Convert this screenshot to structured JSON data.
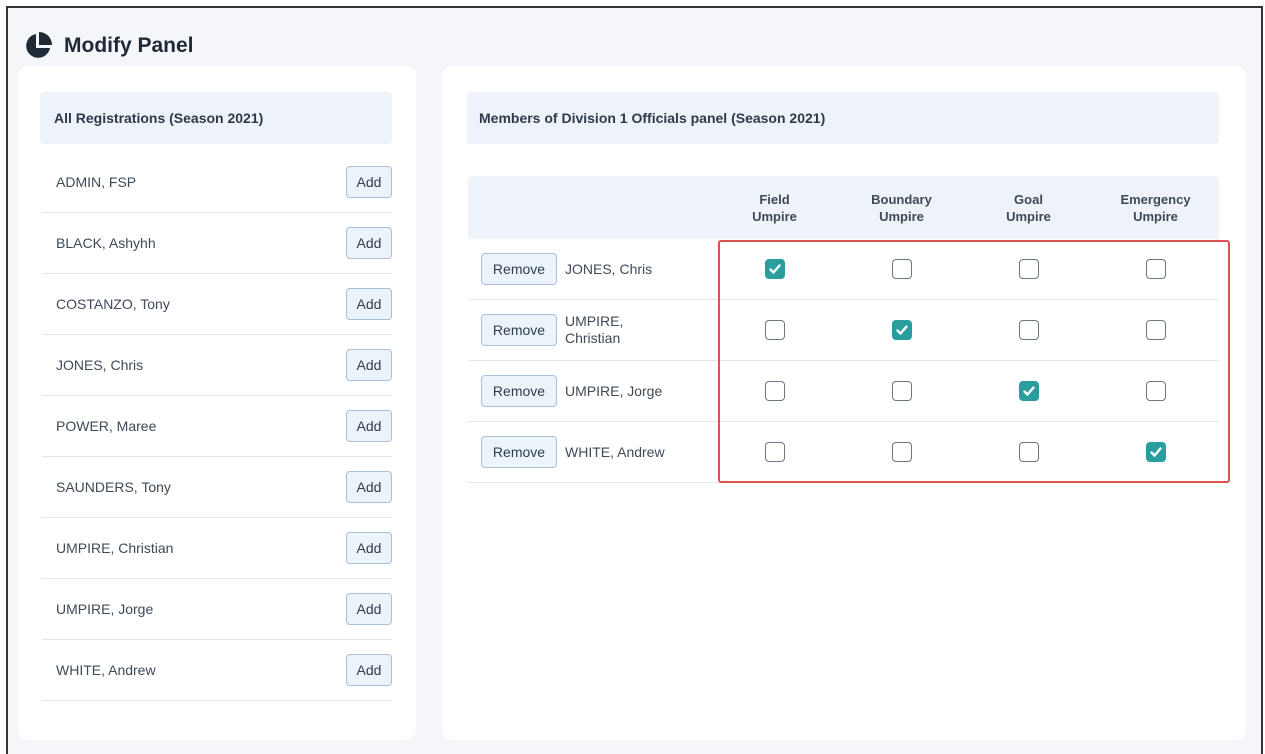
{
  "header": {
    "title": "Modify Panel",
    "icon": "pie-chart-icon"
  },
  "registrations": {
    "title": "All Registrations (Season 2021)",
    "add_label": "Add",
    "items": [
      {
        "name": "ADMIN, FSP"
      },
      {
        "name": "BLACK, Ashyhh"
      },
      {
        "name": "COSTANZO, Tony"
      },
      {
        "name": "JONES, Chris"
      },
      {
        "name": "POWER, Maree"
      },
      {
        "name": "SAUNDERS, Tony"
      },
      {
        "name": "UMPIRE, Christian"
      },
      {
        "name": "UMPIRE, Jorge"
      },
      {
        "name": "WHITE, Andrew"
      }
    ]
  },
  "members": {
    "title": "Members of Division 1 Officials panel (Season 2021)",
    "remove_label": "Remove",
    "columns": [
      {
        "line1": "Field",
        "line2": "Umpire"
      },
      {
        "line1": "Boundary",
        "line2": "Umpire"
      },
      {
        "line1": "Goal",
        "line2": "Umpire"
      },
      {
        "line1": "Emergency",
        "line2": "Umpire"
      }
    ],
    "rows": [
      {
        "name_line1": "JONES, Chris",
        "name_line2": "",
        "checks": [
          true,
          false,
          false,
          false
        ]
      },
      {
        "name_line1": "UMPIRE,",
        "name_line2": "Christian",
        "checks": [
          false,
          true,
          false,
          false
        ]
      },
      {
        "name_line1": "UMPIRE, Jorge",
        "name_line2": "",
        "checks": [
          false,
          false,
          true,
          false
        ]
      },
      {
        "name_line1": "WHITE, Andrew",
        "name_line2": "",
        "checks": [
          false,
          false,
          false,
          true
        ]
      }
    ]
  },
  "colors": {
    "checkbox_checked": "#2a9d9e",
    "highlight_border": "#d9534f",
    "card_header_bg": "#eef3f9"
  }
}
